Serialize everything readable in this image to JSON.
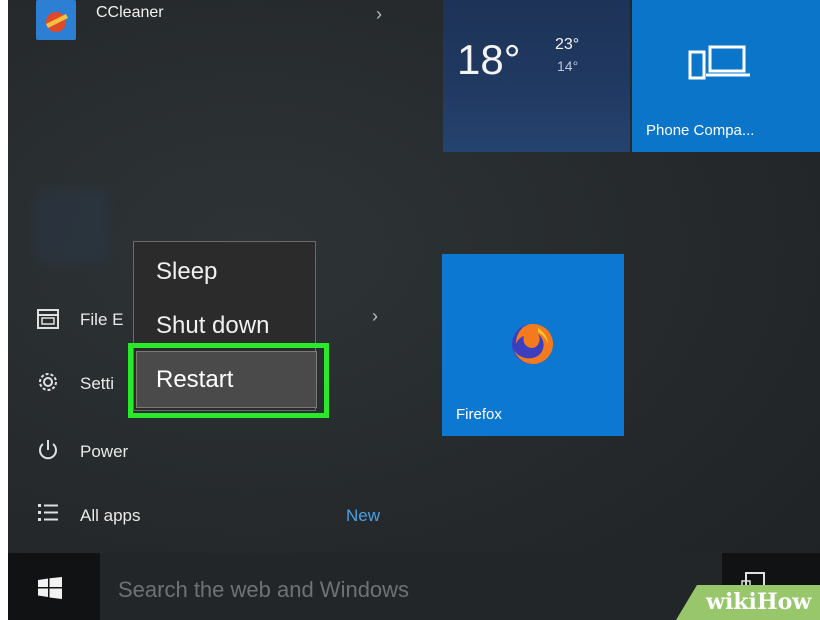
{
  "start_menu": {
    "apps": [
      {
        "label": "CCleaner",
        "icon": "ccleaner-icon"
      }
    ],
    "sidebar": {
      "file_explorer": "File E",
      "settings": "Setti",
      "power": "Power",
      "all_apps": "All apps",
      "new_badge": "New"
    }
  },
  "power_menu": {
    "items": [
      "Sleep",
      "Shut down",
      "Restart"
    ],
    "highlighted": "Restart",
    "highlight_color": "#2ae82a"
  },
  "tiles": {
    "weather": {
      "temp": "18°",
      "high": "23°",
      "low": "14°"
    },
    "phone": {
      "label": "Phone Compa..."
    },
    "firefox": {
      "label": "Firefox"
    }
  },
  "taskbar": {
    "search_placeholder": "Search the web and Windows"
  },
  "watermark": {
    "text": "wikiHow"
  },
  "colors": {
    "tile_blue": "#0a75c9",
    "accent_new": "#4aa0e6"
  }
}
